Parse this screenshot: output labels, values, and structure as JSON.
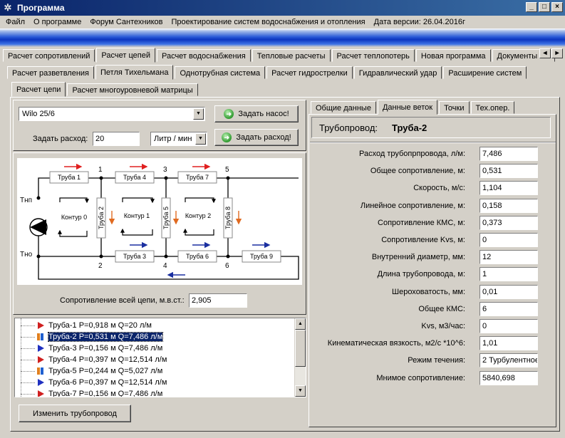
{
  "window": {
    "title": "Программа",
    "buttons": [
      "_",
      "□",
      "×"
    ]
  },
  "menu": [
    "Файл",
    "О программе",
    "Форум Сантехников",
    "Проектирование систем водоснабжения и отопления",
    "Дата версии: 26.04.2016г"
  ],
  "tabs_level1": [
    "Расчет сопротивлений",
    "Расчет цепей",
    "Расчет водоснабжения",
    "Тепловые расчеты",
    "Расчет теплопотерь",
    "Новая программа",
    "Документы и л"
  ],
  "tabs_level1_active": 1,
  "tabs_level2": [
    "Расчет разветвления",
    "Петля Тихельмана",
    "Однотрубная система",
    "Расчет гидрострелки",
    "Гидравлический удар",
    "Расширение систем"
  ],
  "tabs_level2_active": 1,
  "tabs_level3": [
    "Расчет цепи",
    "Расчет многоуровневой матрицы"
  ],
  "tabs_level3_active": 0,
  "left": {
    "pump": "Wilo 25/6",
    "set_pump_button": "Задать насос!",
    "flow_label": "Задать расход:",
    "flow_value": "20",
    "flow_unit": "Литр / мин",
    "set_flow_button": "Задать расход!",
    "resistance_label": "Сопротивление всей цепи, м.в.ст.:",
    "resistance_value": "2,905",
    "change_button": "Изменить трубопровод"
  },
  "diagram": {
    "labels": {
      "pipe1": "Труба 1",
      "pipe2": "Труба 2",
      "pipe3": "Труба 3",
      "pipe4": "Труба 4",
      "pipe5": "Труба 5",
      "pipe6": "Труба 6",
      "pipe7": "Труба 7",
      "pipe8": "Труба 8",
      "pipe9": "Труба 9",
      "loop0": "Контур 0",
      "loop1": "Контур 1",
      "loop2": "Контур 2",
      "tnp": "Тнп",
      "tno": "Тно",
      "n1": "1",
      "n2": "2",
      "n3": "3",
      "n4": "4",
      "n5": "5",
      "n6": "6"
    }
  },
  "tree_items": [
    {
      "text": "Труба-1 P=0,918 м Q=20 л/м",
      "icon": "red-flag-icon"
    },
    {
      "text": "Труба-2 P=0,531 м Q=7,486 л/м",
      "icon": "bar-icon",
      "selected": true
    },
    {
      "text": "Труба-3 P=0,156 м Q=7,486 л/м",
      "icon": "blue-flag-icon"
    },
    {
      "text": "Труба-4 P=0,397 м Q=12,514 л/м",
      "icon": "red-flag-icon"
    },
    {
      "text": "Труба-5 P=0,244 м Q=5,027 л/м",
      "icon": "bar-icon"
    },
    {
      "text": "Труба-6 P=0,397 м Q=12,514 л/м",
      "icon": "blue-flag-icon"
    },
    {
      "text": "Труба-7 P=0,156 м Q=7,486 л/м",
      "icon": "red-flag-icon"
    }
  ],
  "right": {
    "tabs": [
      "Общие данные",
      "Данные веток",
      "Точки",
      "Тех.опер."
    ],
    "tabs_active": 1,
    "header_label": "Трубопровод:",
    "header_value": "Труба-2",
    "props": [
      {
        "label": "Расход трубопрпровода, л/м:",
        "value": "7,486"
      },
      {
        "label": "Общее сопротивление, м:",
        "value": "0,531"
      },
      {
        "label": "Скорость, м/с:",
        "value": "1,104"
      },
      {
        "label": "Линейное сопротивление, м:",
        "value": "0,158"
      },
      {
        "label": "Сопротивление КМС, м:",
        "value": "0,373"
      },
      {
        "label": "Сопротивление Kvs, м:",
        "value": "0"
      },
      {
        "label": "Внутренний диаметр, мм:",
        "value": "12"
      },
      {
        "label": "Длина трубопровода, м:",
        "value": "1"
      },
      {
        "label": "Шероховатость, мм:",
        "value": "0,01"
      },
      {
        "label": "Общее КМС:",
        "value": "6"
      },
      {
        "label": "Kvs, м3/час:",
        "value": "0"
      },
      {
        "label": "Кинематическая вязкость, м2/с *10^6:",
        "value": "1,01"
      },
      {
        "label": "Режим течения:",
        "value": "2 Турбулентное"
      },
      {
        "label": "Мнимое сопротивление:",
        "value": "5840,698"
      }
    ]
  },
  "colors": {
    "title_start": "#0a246a",
    "title_end": "#3a6ea5",
    "arrow_red": "#e02020",
    "arrow_blue": "#1a2fa0",
    "selection": "#0a246a"
  }
}
